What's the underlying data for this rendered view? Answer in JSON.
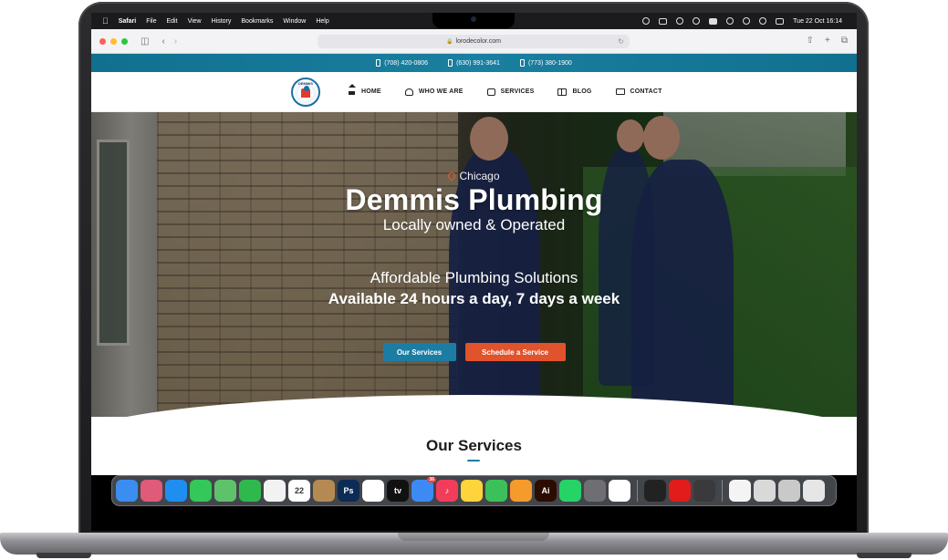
{
  "menubar": {
    "app_name": "Safari",
    "menus": [
      "File",
      "Edit",
      "View",
      "History",
      "Bookmarks",
      "Window",
      "Help"
    ],
    "clock": "Tue 22 Oct  16:14"
  },
  "browser": {
    "url": "lorodecolor.com"
  },
  "topbar": {
    "phones": [
      "(708) 420-0806",
      "(630) 991-3641",
      "(773) 380-1900"
    ]
  },
  "nav": {
    "logo_text": "DEMMIS",
    "items": [
      {
        "label": "HOME",
        "icon": "home-icon"
      },
      {
        "label": "WHO WE ARE",
        "icon": "people-icon"
      },
      {
        "label": "SERVICES",
        "icon": "briefcase-icon"
      },
      {
        "label": "BLOG",
        "icon": "book-icon"
      },
      {
        "label": "CONTACT",
        "icon": "mail-icon"
      }
    ]
  },
  "hero": {
    "location": "Chicago",
    "title": "Demmis Plumbing",
    "subtitle": "Locally owned & Operated",
    "tagline1": "Affordable Plumbing Solutions",
    "tagline2": "Available 24 hours a day, 7 days a week",
    "btn_services": "Our Services",
    "btn_schedule": "Schedule a Service"
  },
  "section": {
    "title": "Our Services"
  },
  "dock": {
    "apps": [
      {
        "name": "finder-icon",
        "color": "#3c8df0",
        "glyph": ""
      },
      {
        "name": "launchpad-icon",
        "color": "#e05a7a",
        "glyph": ""
      },
      {
        "name": "safari-icon",
        "color": "#1f8ef1",
        "glyph": ""
      },
      {
        "name": "messages-icon",
        "color": "#34c759",
        "glyph": ""
      },
      {
        "name": "maps-icon",
        "color": "#5ec26a",
        "glyph": ""
      },
      {
        "name": "facetime-icon",
        "color": "#2fb94d",
        "glyph": ""
      },
      {
        "name": "photos-icon",
        "color": "#f2f2f2",
        "glyph": ""
      },
      {
        "name": "calendar-icon",
        "color": "#ffffff",
        "glyph": "22"
      },
      {
        "name": "notes-brown-icon",
        "color": "#b58a52",
        "glyph": ""
      },
      {
        "name": "photoshop-icon",
        "color": "#0c2b55",
        "glyph": "Ps"
      },
      {
        "name": "reminders-icon",
        "color": "#ffffff",
        "glyph": ""
      },
      {
        "name": "appletv-icon",
        "color": "#111111",
        "glyph": "tv"
      },
      {
        "name": "mail-app-icon",
        "color": "#3d8af5",
        "glyph": "",
        "badge": "36"
      },
      {
        "name": "music-icon",
        "color": "#f23d5a",
        "glyph": "♪"
      },
      {
        "name": "notes-icon",
        "color": "#ffd43b",
        "glyph": ""
      },
      {
        "name": "numbers-icon",
        "color": "#3cc15a",
        "glyph": ""
      },
      {
        "name": "pages-icon",
        "color": "#f59b2b",
        "glyph": ""
      },
      {
        "name": "illustrator-icon",
        "color": "#2b0d00",
        "glyph": "Ai"
      },
      {
        "name": "whatsapp-icon",
        "color": "#25d366",
        "glyph": ""
      },
      {
        "name": "system-icon",
        "color": "#6e6e73",
        "glyph": ""
      },
      {
        "name": "chrome-icon",
        "color": "#ffffff",
        "glyph": ""
      },
      {
        "name": "activity-monitor-icon",
        "color": "#222222",
        "glyph": ""
      },
      {
        "name": "acrobat-icon",
        "color": "#e21b1b",
        "glyph": ""
      },
      {
        "name": "calculator-icon",
        "color": "#3a3a3c",
        "glyph": ""
      },
      {
        "name": "document-icon",
        "color": "#f4f4f4",
        "glyph": ""
      },
      {
        "name": "keyboard-icon",
        "color": "#d9d9d9",
        "glyph": ""
      },
      {
        "name": "preview-icon",
        "color": "#c9c9c9",
        "glyph": ""
      },
      {
        "name": "trash-icon",
        "color": "#e6e6e6",
        "glyph": ""
      }
    ]
  }
}
